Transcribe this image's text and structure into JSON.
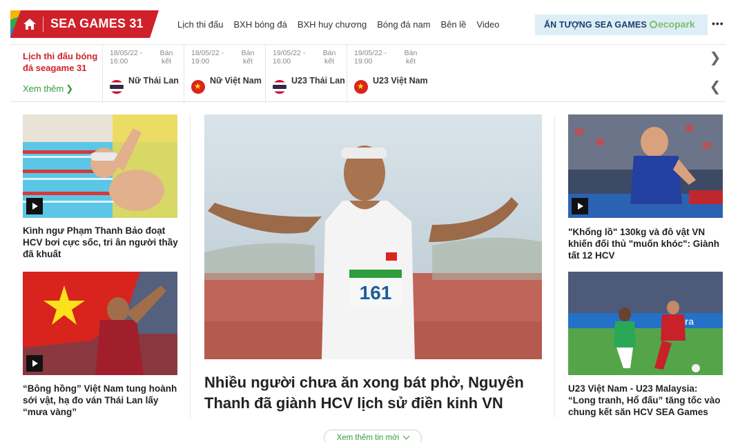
{
  "nav": {
    "brand": "SEA GAMES 31",
    "links": [
      "Lịch thi đấu",
      "BXH bóng đá",
      "BXH huy chương",
      "Bóng đá nam",
      "Bên lề",
      "Video"
    ],
    "highlight": "ẤN TƯỢNG SEA GAMES",
    "sponsor": "ecopark",
    "more": "•••"
  },
  "schedule": {
    "title": "Lịch thi đấu bóng đá seagame 31",
    "more_label": "Xem thêm",
    "more_arrow": "❯",
    "matches": [
      {
        "date": "18/05/22 - 16:00",
        "status": "Bán kết",
        "team": "Nữ Thái Lan",
        "flag": "thailand-flag"
      },
      {
        "date": "18/05/22 - 19:00",
        "status": "Bán kết",
        "team": "Nữ Việt Nam",
        "flag": "vietnam-flag"
      },
      {
        "date": "19/05/22 - 16:00",
        "status": "Bán kết",
        "team": "U23 Thái Lan",
        "flag": "thailand-flag"
      },
      {
        "date": "19/05/22 - 19:00",
        "status": "Bán kết",
        "team": "U23 Việt Nam",
        "flag": "vietnam-flag"
      }
    ],
    "next_arrow": "❯",
    "prev_arrow": "❮"
  },
  "articles": {
    "left_top": "Kình ngư Phạm Thanh Bảo đoạt HCV bơi cực sốc, tri ân người thầy đã khuất",
    "left_bottom": "“Bông hồng” Việt Nam tung hoành sới vật, hạ đo ván Thái Lan lấy “mưa vàng”",
    "main": "Nhiều người chưa ăn xong bát phở, Nguyên Thanh đã giành HCV lịch sử điền kinh VN",
    "main_bib": "161",
    "right_top": "\"Khổng lồ\" 130kg và đô vật VN khiến đối thủ \"muốn khóc\": Giành tất 12 HCV",
    "right_bottom": "U23 Việt Nam - U23 Malaysia: “Long tranh, Hổ đấu” tăng tốc vào chung kết săn HCV SEA Games"
  },
  "more_news": "Xem thêm tin mới",
  "colors": {
    "brand": "#d0212a",
    "accent_green": "#2e9d3c",
    "highlight_bg": "#ddeef7"
  }
}
